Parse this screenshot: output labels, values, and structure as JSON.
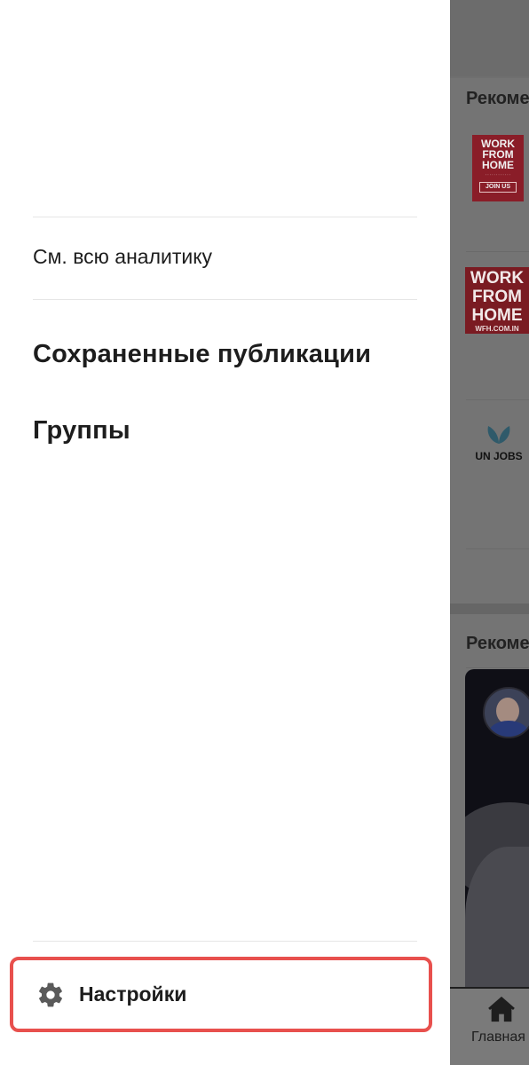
{
  "drawer": {
    "analytics_link": "См. всю аналитику",
    "menu_items": [
      {
        "label": "Сохраненные публикации"
      },
      {
        "label": "Группы"
      }
    ],
    "settings": {
      "label": "Настройки",
      "icon": "gear-icon"
    },
    "colors": {
      "highlight_border": "#e8504d"
    }
  },
  "feed": {
    "section_title_1": "Рекоме",
    "section_title_2": "Рекоме",
    "ads": [
      {
        "line1": "WORK",
        "line2": "FROM",
        "line3": "HOME",
        "button": "JOIN US"
      },
      {
        "line1": "WORK",
        "line2": "FROM",
        "line3": "HOME",
        "url": "WFH.COM.IN"
      },
      {
        "logo_text": "UN JOBS"
      }
    ],
    "tabbar": {
      "home_label": "Главная",
      "home_icon": "home-icon"
    }
  }
}
